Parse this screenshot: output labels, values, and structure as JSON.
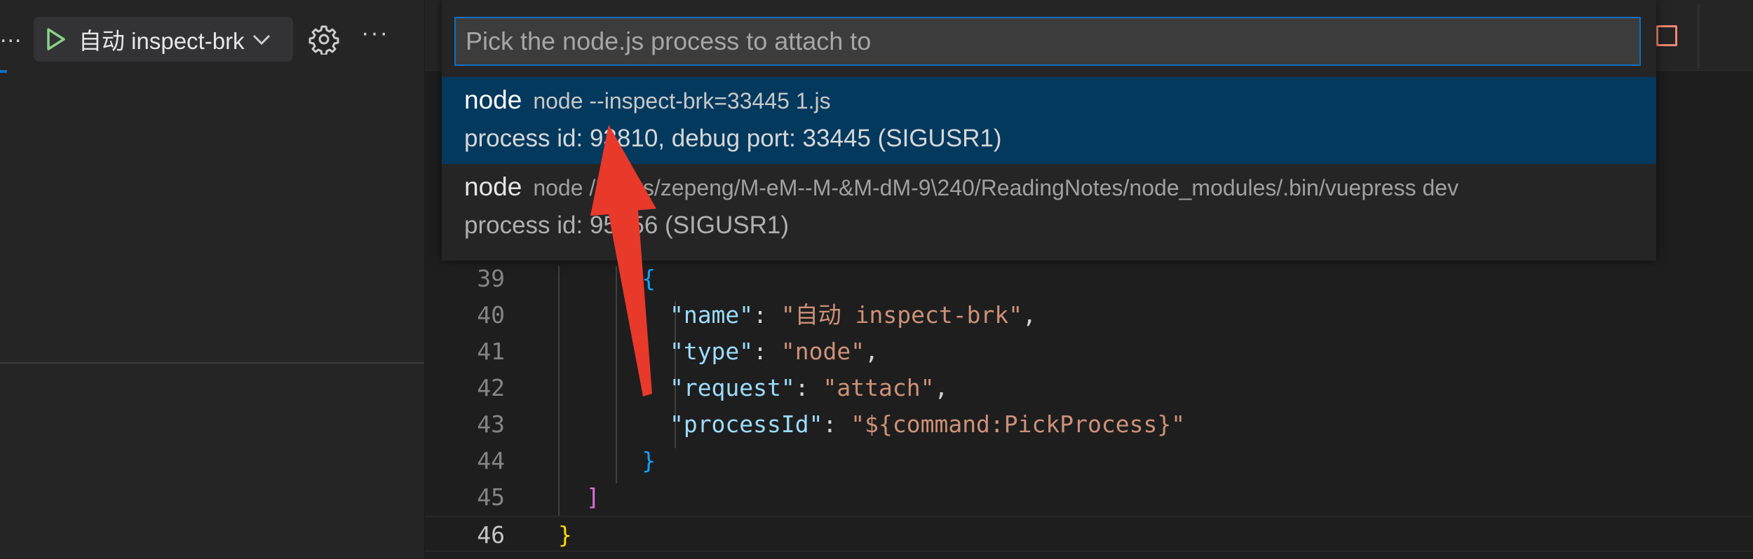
{
  "sidebar": {
    "overflow_label": "...",
    "launch_config": "自动 inspect-brk",
    "more_label": "···",
    "icons": {
      "play": "play-icon",
      "chevron": "chevron-down-icon",
      "settings": "gear-icon",
      "more": "more-icon"
    },
    "colors": {
      "play": "#89d185",
      "focus": "#0e70c0"
    }
  },
  "editor": {
    "lines": [
      {
        "no": "39",
        "indent": "      ",
        "parts": [
          {
            "t": "{",
            "c": "tok-brace3"
          }
        ]
      },
      {
        "no": "40",
        "indent": "        ",
        "parts": [
          {
            "t": "\"name\"",
            "c": "tok-key"
          },
          {
            "t": ": ",
            "c": "tok-punc"
          },
          {
            "t": "\"自动 inspect-brk\"",
            "c": "tok-str"
          },
          {
            "t": ",",
            "c": "tok-punc"
          }
        ]
      },
      {
        "no": "41",
        "indent": "        ",
        "parts": [
          {
            "t": "\"type\"",
            "c": "tok-key"
          },
          {
            "t": ": ",
            "c": "tok-punc"
          },
          {
            "t": "\"node\"",
            "c": "tok-str"
          },
          {
            "t": ",",
            "c": "tok-punc"
          }
        ]
      },
      {
        "no": "42",
        "indent": "        ",
        "parts": [
          {
            "t": "\"request\"",
            "c": "tok-key"
          },
          {
            "t": ": ",
            "c": "tok-punc"
          },
          {
            "t": "\"attach\"",
            "c": "tok-str"
          },
          {
            "t": ",",
            "c": "tok-punc"
          }
        ]
      },
      {
        "no": "43",
        "indent": "        ",
        "parts": [
          {
            "t": "\"processId\"",
            "c": "tok-key"
          },
          {
            "t": ": ",
            "c": "tok-punc"
          },
          {
            "t": "\"${command:PickProcess}\"",
            "c": "tok-str"
          }
        ]
      },
      {
        "no": "44",
        "indent": "      ",
        "parts": [
          {
            "t": "}",
            "c": "tok-brace3"
          }
        ]
      },
      {
        "no": "45",
        "indent": "  ",
        "parts": [
          {
            "t": "]",
            "c": "tok-brace2"
          }
        ]
      },
      {
        "no": "46",
        "indent": "",
        "parts": [
          {
            "t": "}",
            "c": "tok-brace1"
          }
        ]
      }
    ],
    "current_line": "46",
    "stop_icon": "stop-icon"
  },
  "quick_pick": {
    "placeholder": "Pick the node.js process to attach to",
    "items": [
      {
        "label": "node",
        "description": "node --inspect-brk=33445 1.js",
        "detail": "process id: 93810, debug port: 33445 (SIGUSR1)",
        "selected": true
      },
      {
        "label": "node",
        "description": "node /Users/zepeng/M-eM--M-&M-dM-9\\240/ReadingNotes/node_modules/.bin/vuepress dev",
        "detail": "process id: 95256 (SIGUSR1)",
        "selected": false
      }
    ],
    "colors": {
      "selected_bg": "#04395e",
      "input_border": "#0e70c0"
    }
  },
  "annotation": {
    "arrow_color": "#e8392b"
  }
}
